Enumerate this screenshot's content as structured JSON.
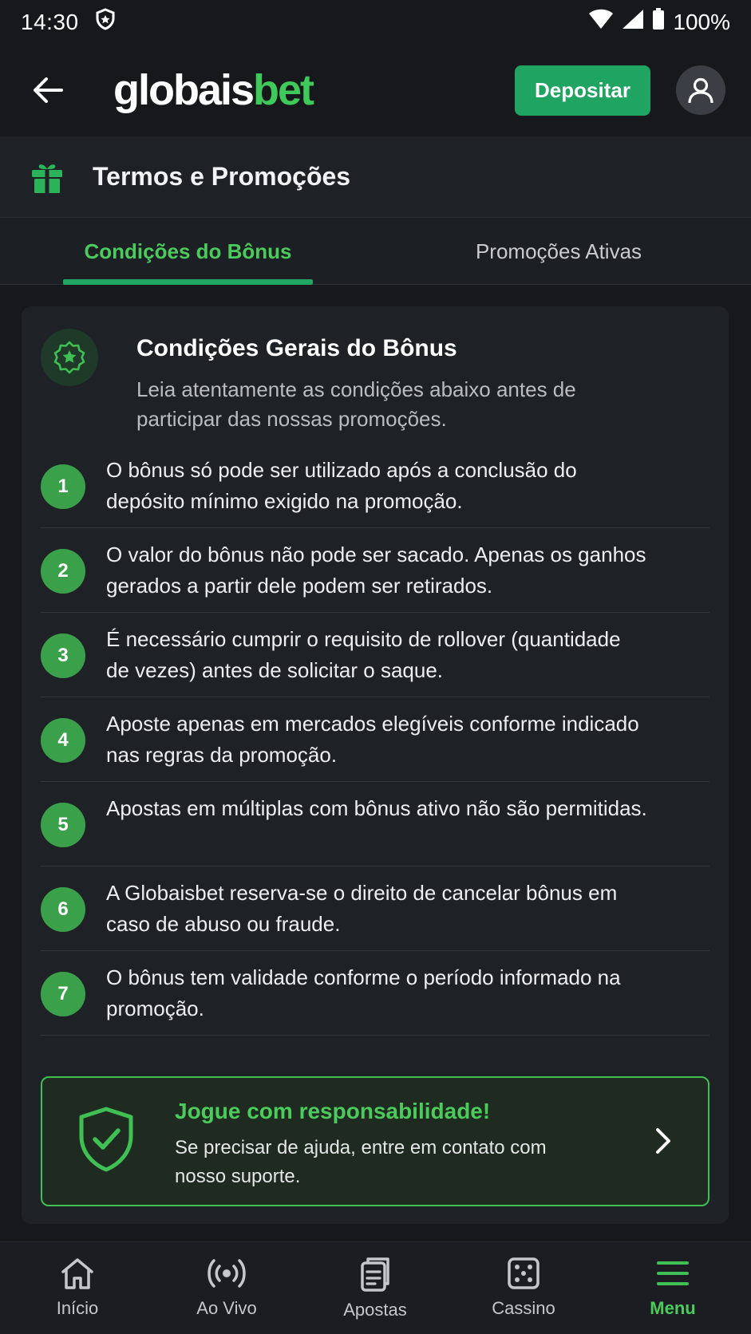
{
  "status_bar": {
    "time": "14:30",
    "battery": "100%"
  },
  "header": {
    "logo_part1": "globais",
    "logo_part2": "bet",
    "deposit_label": "Depositar"
  },
  "page": {
    "title": "Termos e Promoções"
  },
  "tabs": [
    {
      "label": "Condições do Bônus",
      "active": true
    },
    {
      "label": "Promoções Ativas",
      "active": false
    }
  ],
  "card": {
    "title": "Condições Gerais do Bônus",
    "subtitle": "Leia atentamente as condições abaixo antes de participar das nossas promoções.",
    "rules": [
      {
        "num": "1",
        "text": "O bônus só pode ser utilizado após a conclusão do depósito mínimo exigido na promoção."
      },
      {
        "num": "2",
        "text": "O valor do bônus não pode ser sacado. Apenas os ganhos gerados a partir dele podem ser retirados."
      },
      {
        "num": "3",
        "text": "É necessário cumprir o requisito de rollover (quantidade de vezes) antes de solicitar o saque."
      },
      {
        "num": "4",
        "text": "Aposte apenas em mercados elegíveis conforme indicado nas regras da promoção."
      },
      {
        "num": "5",
        "text": "Apostas em múltiplas com bônus ativo não são permitidas."
      },
      {
        "num": "6",
        "text": "A Globaisbet reserva-se o direito de cancelar bônus em caso de abuso ou fraude."
      },
      {
        "num": "7",
        "text": "O bônus tem validade conforme o período informado na promoção."
      }
    ]
  },
  "responsible": {
    "title": "Jogue com responsabilidade!",
    "text": "Se precisar de ajuda, entre em contato com nosso suporte."
  },
  "bottom_nav": [
    {
      "label": "Início",
      "icon": "home-icon"
    },
    {
      "label": "Ao Vivo",
      "icon": "live-icon"
    },
    {
      "label": "Apostas",
      "icon": "bets-icon"
    },
    {
      "label": "Cassino",
      "icon": "casino-icon"
    },
    {
      "label": "Menu",
      "icon": "menu-icon",
      "active": true
    }
  ],
  "colors": {
    "accent": "#1fa462",
    "accent_text": "#4ccb5d",
    "background": "#16181c",
    "card": "#1e2126"
  }
}
